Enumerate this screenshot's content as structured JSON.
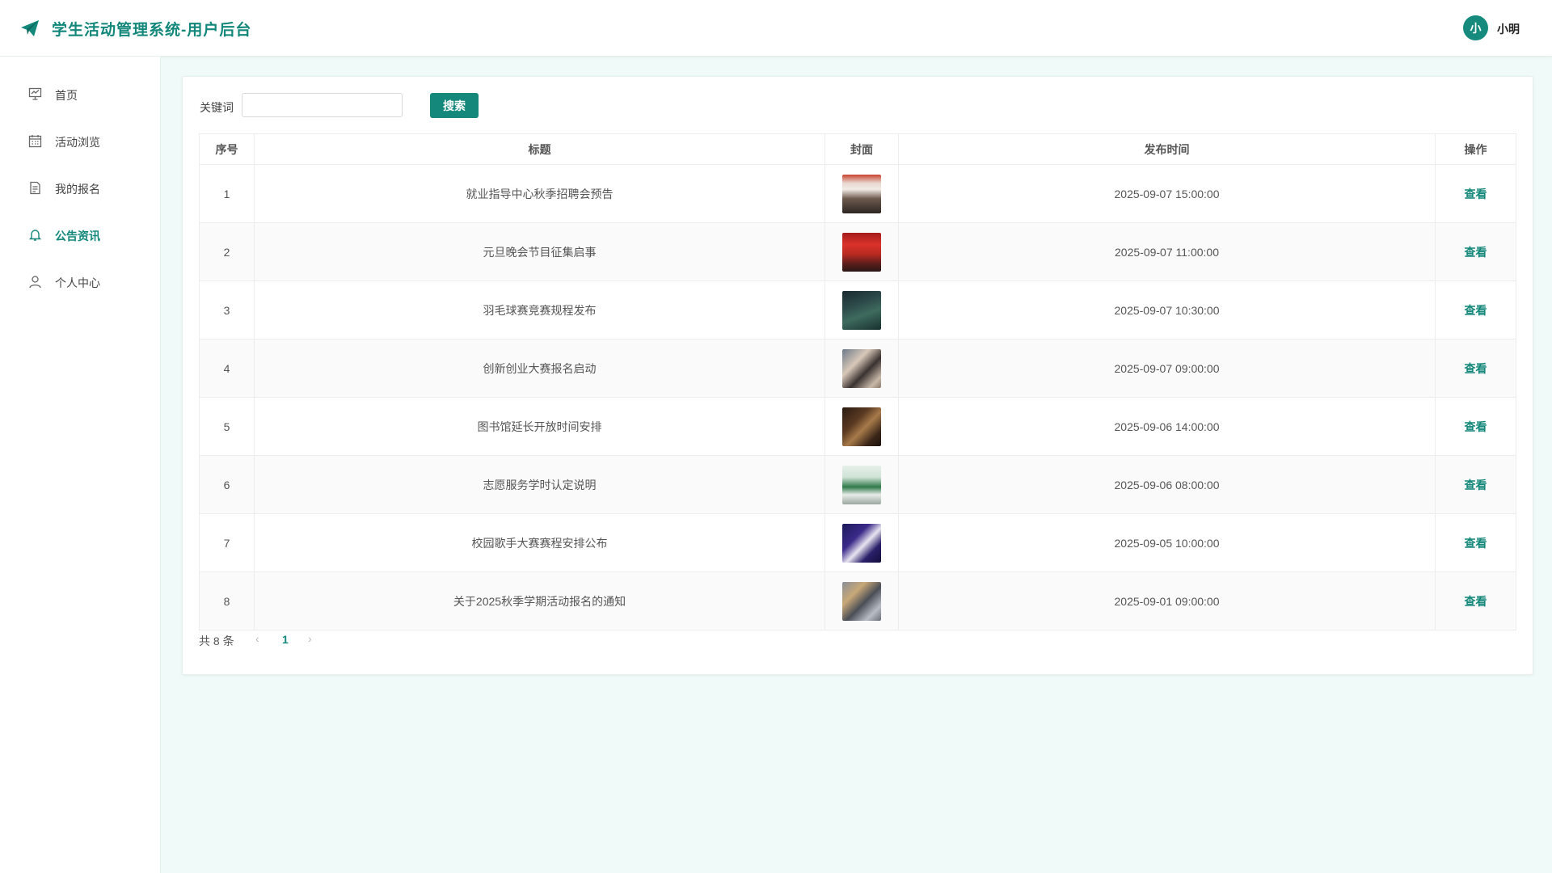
{
  "header": {
    "title": "学生活动管理系统-用户后台",
    "user_avatar": "小",
    "user_name": "小明",
    "logo_icon": "paper-plane-icon"
  },
  "sidebar": {
    "items": [
      {
        "label": "首页",
        "icon": "dashboard-icon",
        "active": false
      },
      {
        "label": "活动浏览",
        "icon": "calendar-icon",
        "active": false
      },
      {
        "label": "我的报名",
        "icon": "document-icon",
        "active": false
      },
      {
        "label": "公告资讯",
        "icon": "bell-icon",
        "active": true
      },
      {
        "label": "个人中心",
        "icon": "user-icon",
        "active": false
      }
    ]
  },
  "search": {
    "label": "关键词",
    "value": "",
    "placeholder": "",
    "button_label": "搜索"
  },
  "table": {
    "columns": [
      "序号",
      "标题",
      "封面",
      "发布时间",
      "操作"
    ],
    "rows": [
      {
        "index": "1",
        "title": "就业指导中心秋季招聘会预告",
        "time": "2025-09-07 15:00:00",
        "action": "查看"
      },
      {
        "index": "2",
        "title": "元旦晚会节目征集启事",
        "time": "2025-09-07 11:00:00",
        "action": "查看"
      },
      {
        "index": "3",
        "title": "羽毛球赛竞赛规程发布",
        "time": "2025-09-07 10:30:00",
        "action": "查看"
      },
      {
        "index": "4",
        "title": "创新创业大赛报名启动",
        "time": "2025-09-07 09:00:00",
        "action": "查看"
      },
      {
        "index": "5",
        "title": "图书馆延长开放时间安排",
        "time": "2025-09-06 14:00:00",
        "action": "查看"
      },
      {
        "index": "6",
        "title": "志愿服务学时认定说明",
        "time": "2025-09-06 08:00:00",
        "action": "查看"
      },
      {
        "index": "7",
        "title": "校园歌手大赛赛程安排公布",
        "time": "2025-09-05 10:00:00",
        "action": "查看"
      },
      {
        "index": "8",
        "title": "关于2025秋季学期活动报名的通知",
        "time": "2025-09-01 09:00:00",
        "action": "查看"
      }
    ]
  },
  "pagination": {
    "total_text": "共 8 条",
    "current_page": "1",
    "prev_symbol": "‹",
    "next_symbol": "›"
  },
  "colors": {
    "accent": "#14887b",
    "background": "#f0fbf9"
  }
}
